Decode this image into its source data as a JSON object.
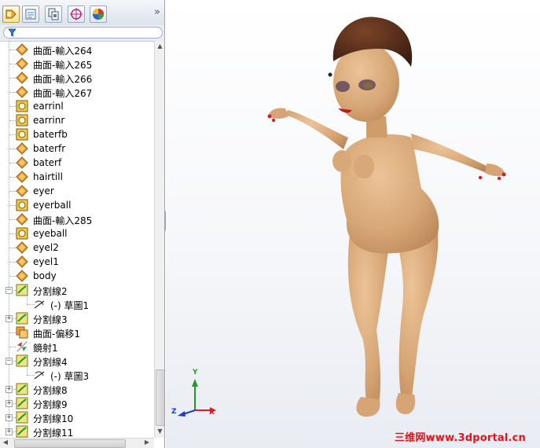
{
  "toolbar": {
    "tabs": [
      {
        "icon": "feature-manager-icon",
        "active": true
      },
      {
        "icon": "property-manager-icon",
        "active": false
      },
      {
        "icon": "configuration-manager-icon",
        "active": false
      },
      {
        "icon": "dimxpert-icon",
        "active": false
      },
      {
        "icon": "display-manager-icon",
        "active": false
      }
    ],
    "more_icon": "chevron-double-right-icon",
    "filter_icon": "filter-icon"
  },
  "tree": {
    "items": [
      {
        "label": "曲面-輸入264",
        "icon": "imported-surface-icon",
        "indent": 0,
        "expander": ""
      },
      {
        "label": "曲面-輸入265",
        "icon": "imported-surface-icon",
        "indent": 0,
        "expander": ""
      },
      {
        "label": "曲面-輸入266",
        "icon": "imported-surface-icon",
        "indent": 0,
        "expander": ""
      },
      {
        "label": "曲面-輸入267",
        "icon": "imported-surface-icon",
        "indent": 0,
        "expander": ""
      },
      {
        "label": "earrinl",
        "icon": "imported-solid-icon",
        "indent": 0,
        "expander": ""
      },
      {
        "label": "earrinr",
        "icon": "imported-solid-icon",
        "indent": 0,
        "expander": ""
      },
      {
        "label": "baterfb",
        "icon": "imported-solid-icon",
        "indent": 0,
        "expander": ""
      },
      {
        "label": "baterfr",
        "icon": "imported-surface-icon",
        "indent": 0,
        "expander": ""
      },
      {
        "label": "baterf",
        "icon": "imported-surface-icon",
        "indent": 0,
        "expander": ""
      },
      {
        "label": "hairtill",
        "icon": "imported-surface-icon",
        "indent": 0,
        "expander": ""
      },
      {
        "label": "eyer",
        "icon": "imported-surface-icon",
        "indent": 0,
        "expander": ""
      },
      {
        "label": "eyerball",
        "icon": "imported-solid-icon",
        "indent": 0,
        "expander": ""
      },
      {
        "label": "曲面-輸入285",
        "icon": "imported-surface-icon",
        "indent": 0,
        "expander": ""
      },
      {
        "label": "eyeball",
        "icon": "imported-solid-icon",
        "indent": 0,
        "expander": ""
      },
      {
        "label": "eyel2",
        "icon": "imported-surface-icon",
        "indent": 0,
        "expander": ""
      },
      {
        "label": "eyel1",
        "icon": "imported-surface-icon",
        "indent": 0,
        "expander": ""
      },
      {
        "label": "body",
        "icon": "imported-surface-icon",
        "indent": 0,
        "expander": ""
      },
      {
        "label": "分割線2",
        "icon": "split-line-icon",
        "indent": 0,
        "expander": "−"
      },
      {
        "label": "(-) 草圖1",
        "icon": "sketch-icon",
        "indent": 1,
        "expander": ""
      },
      {
        "label": "分割線3",
        "icon": "split-line-icon",
        "indent": 0,
        "expander": "+"
      },
      {
        "label": "曲面-偏移1",
        "icon": "offset-surface-icon",
        "indent": 0,
        "expander": ""
      },
      {
        "label": "鏡射1",
        "icon": "mirror-icon",
        "indent": 0,
        "expander": ""
      },
      {
        "label": "分割線4",
        "icon": "split-line-icon",
        "indent": 0,
        "expander": "−"
      },
      {
        "label": "(-) 草圖3",
        "icon": "sketch-icon",
        "indent": 1,
        "expander": ""
      },
      {
        "label": "分割線8",
        "icon": "split-line-icon",
        "indent": 0,
        "expander": "+"
      },
      {
        "label": "分割線9",
        "icon": "split-line-icon",
        "indent": 0,
        "expander": "+"
      },
      {
        "label": "分割線10",
        "icon": "split-line-icon",
        "indent": 0,
        "expander": "+"
      },
      {
        "label": "分割線11",
        "icon": "split-line-icon",
        "indent": 0,
        "expander": "+"
      }
    ]
  },
  "viewport": {
    "triad": {
      "x_label": "X",
      "y_label": "Y",
      "z_label": "Z"
    },
    "watermark": "三维网www.3dportal.cn"
  },
  "colors": {
    "skin": "#d9a878",
    "hair": "#4a2616",
    "nails": "#d8202a",
    "watermark": "#e0141a",
    "axis_x": "#d42020",
    "axis_y": "#1e9a2a",
    "axis_z": "#1e3ad0"
  }
}
